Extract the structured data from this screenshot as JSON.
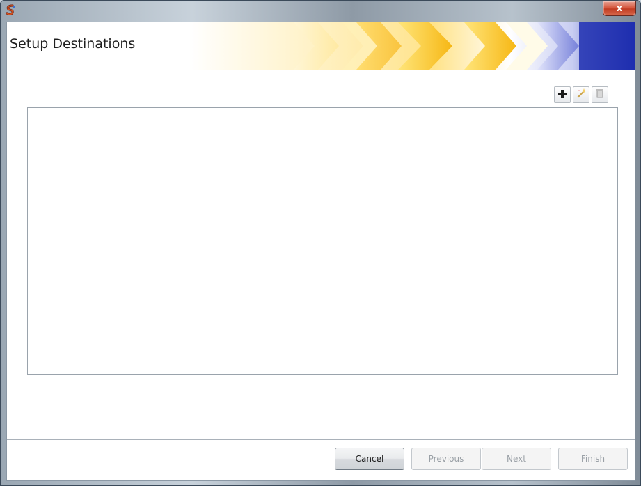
{
  "window": {
    "title": "",
    "close_label": "x"
  },
  "header": {
    "title": "Setup Destinations"
  },
  "toolbar": {
    "add_icon": "plus-icon",
    "edit_icon": "wand-icon",
    "delete_icon": "trash-icon"
  },
  "footer": {
    "cancel_label": "Cancel",
    "previous_label": "Previous",
    "next_label": "Next",
    "finish_label": "Finish"
  },
  "colors": {
    "banner_yellow": "#f7c43a",
    "banner_orange": "#f3a820",
    "banner_blue": "#1f2fb0"
  }
}
